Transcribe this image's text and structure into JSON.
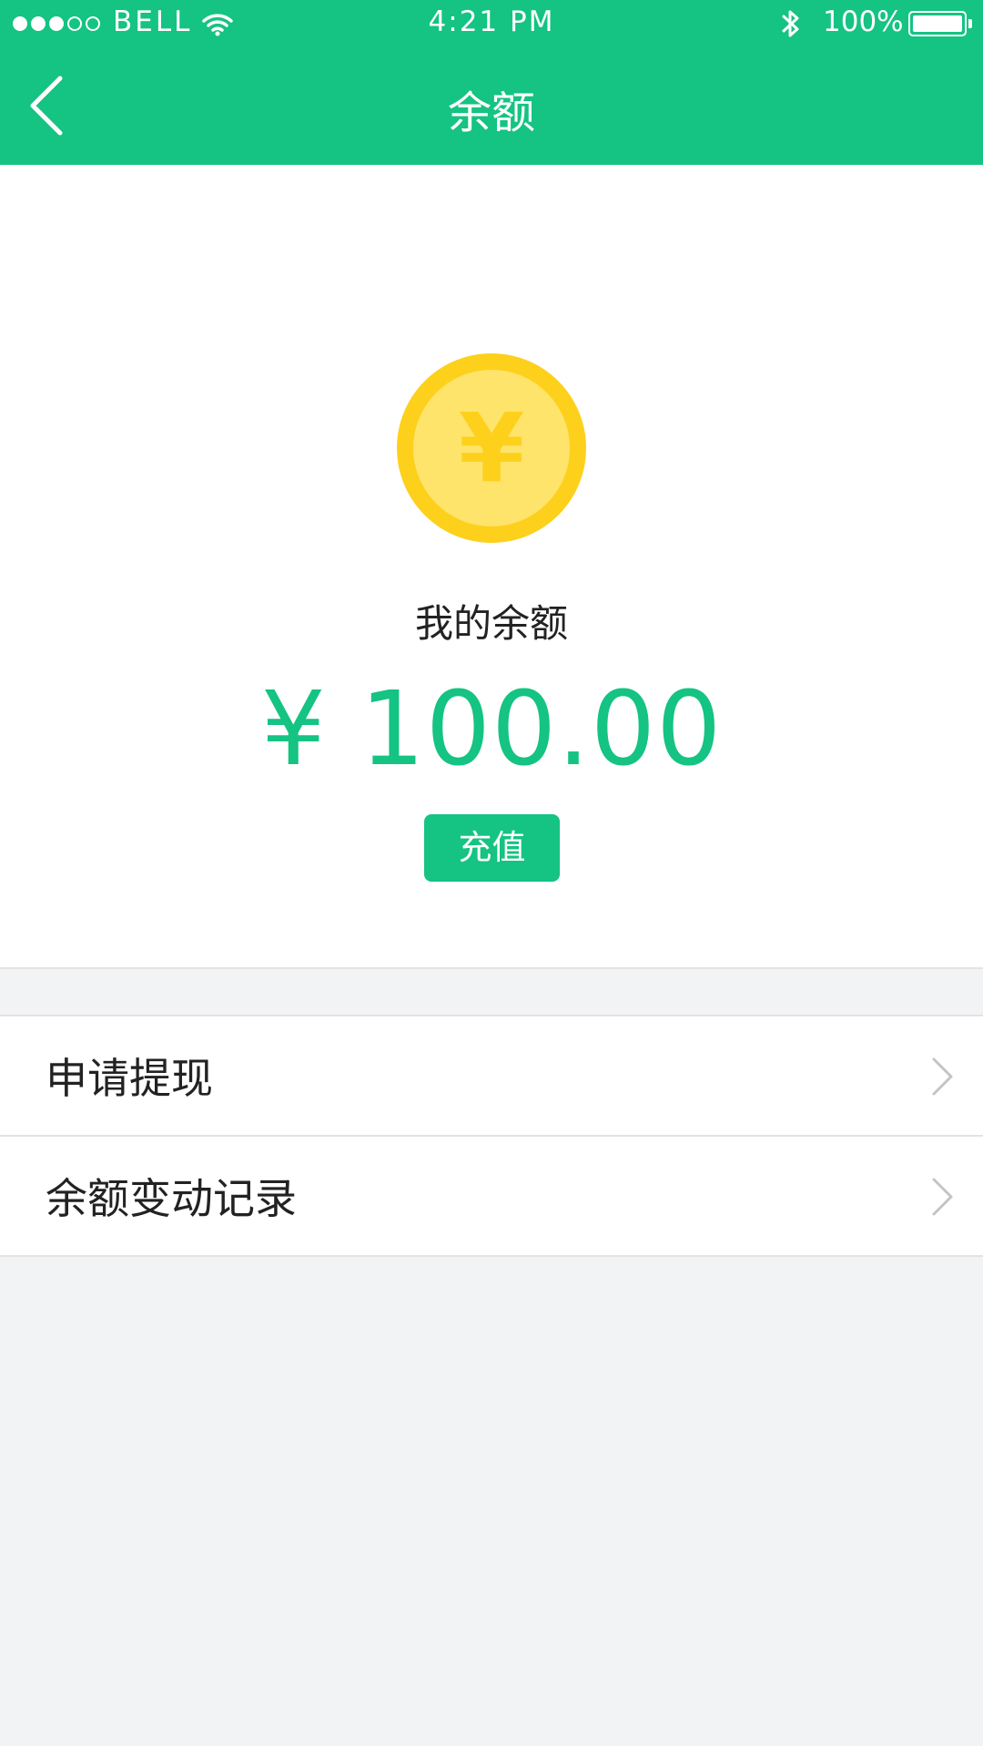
{
  "status_bar": {
    "signal_dots": [
      true,
      true,
      true,
      false,
      false
    ],
    "carrier": "BELL",
    "time": "4:21 PM",
    "battery_percent": "100%",
    "icons": [
      "wifi-icon",
      "bluetooth-icon",
      "battery-icon"
    ]
  },
  "header": {
    "title": "余额",
    "back_icon": "chevron-left-icon"
  },
  "balance": {
    "coin_icon": "yen-coin-icon",
    "coin_symbol": "¥",
    "label": "我的余额",
    "amount": "¥ 100.00",
    "recharge_label": "充值"
  },
  "menu": {
    "items": [
      {
        "label": "申请提现",
        "icon": "chevron-right-icon"
      },
      {
        "label": "余额变动记录",
        "icon": "chevron-right-icon"
      }
    ]
  },
  "colors": {
    "accent": "#15c383",
    "coin_outer": "#fdd01c",
    "coin_inner": "#fee46b",
    "background": "#f2f3f5"
  }
}
